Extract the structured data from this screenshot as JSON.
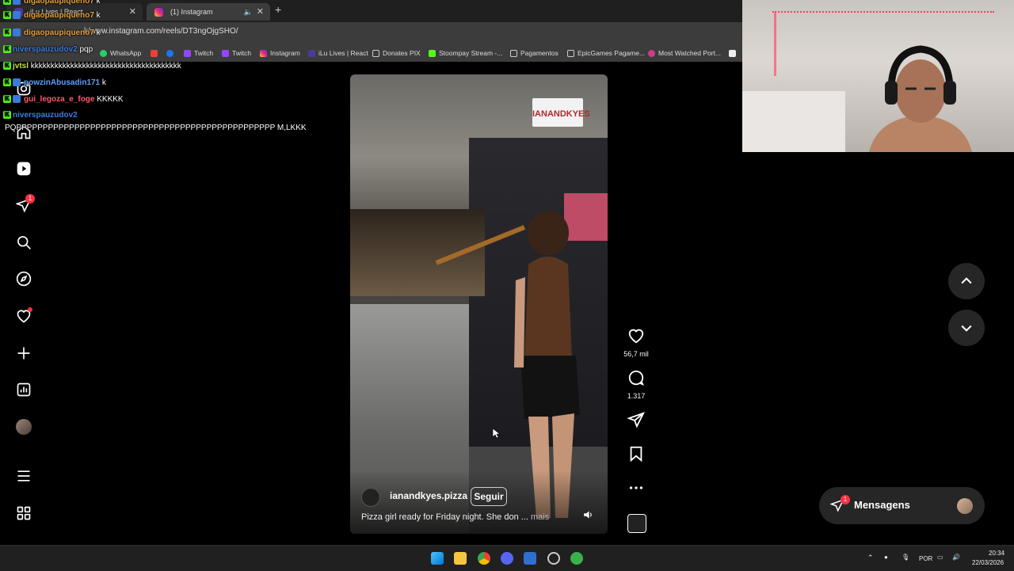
{
  "browser": {
    "tabs": [
      {
        "label": "iLu Lives | React",
        "active": false
      },
      {
        "label": "(1) Instagram",
        "active": true
      }
    ],
    "url": "instagram.com/reels/DT3ngOjgSHO/",
    "url_prefix": "k/www.",
    "bookmarks": [
      "WhatsApp",
      "Twitch",
      "Twitch",
      "Instagram",
      "iLu Lives | React",
      "Donates PIX",
      "Stoompay Stream -...",
      "Pagamentos",
      "EpicGames Pagame...",
      "Most Watched Port..."
    ]
  },
  "chat": [
    {
      "user": "digaopaupiqueno7",
      "msg": "k",
      "color": "#e6a13a"
    },
    {
      "user": "digaopaupiqueno7",
      "msg": "k",
      "color": "#e6a13a"
    },
    {
      "user": "digaopaupiqueno7",
      "msg": "k",
      "color": "#e6a13a"
    },
    {
      "user": "niverspauzudov2",
      "msg": "pqp",
      "color": "#3d7de0"
    },
    {
      "user": "jvtsl",
      "msg": "kkkkkkkkkkkkkkkkkkkkkkkkkkkkkkkkkkkkkk",
      "color": "#c4e23b"
    },
    {
      "user": "powzinAbusadin171",
      "msg": "k",
      "color": "#5aa0ff"
    },
    {
      "user": "gui_legoza_e_foge",
      "msg": "KKKKK",
      "color": "#ff5b6b"
    },
    {
      "user": "niverspauzudov2",
      "msg": "",
      "color": "#3d7de0"
    }
  ],
  "chat_long": "PQPPPPPPPPPPPPPPPPPPPPPPPPPPPPPPPPPPPPPPPPPPPPPPPPP M,LKKK",
  "sidebar": {
    "icons": [
      "instagram-icon",
      "home-icon",
      "reels-icon",
      "direct-icon",
      "search-icon",
      "explore-icon",
      "notifications-icon",
      "create-icon",
      "dashboard-icon",
      "profile-avatar",
      "menu-icon",
      "more-icon"
    ],
    "direct_badge": "1"
  },
  "video": {
    "sign_text": "IANANDKYES",
    "username": "ianandkyes.pizza",
    "follow_label": "Seguir",
    "caption": "Pizza girl ready for Friday night. She don ...",
    "more": "mais"
  },
  "actions": {
    "likes": "56,7 mil",
    "comments": "1.317"
  },
  "messages": {
    "label": "Mensagens",
    "badge": "1"
  },
  "taskbar": {
    "lang": "POR",
    "time": "20:34",
    "date": "22/03/2026"
  }
}
